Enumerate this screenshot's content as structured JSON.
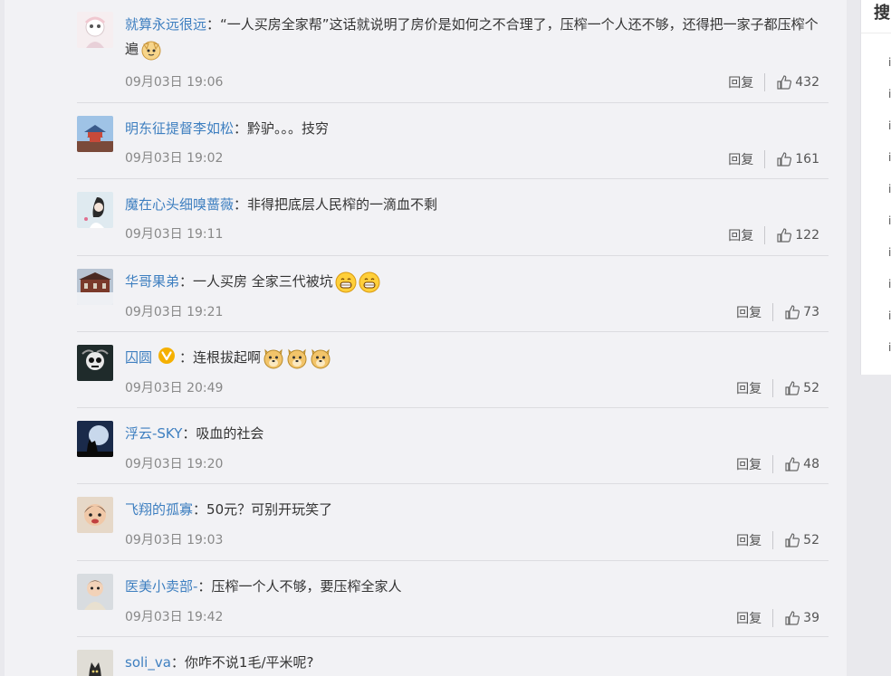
{
  "comments": [
    {
      "user": "就算永远很远",
      "sep": "：",
      "content": "“一人买房全家帮”这话就说明了房价是如何之不合理了，压榨一个人还不够，还得把一家子都压榨个遍",
      "time": "09月03日 19:06",
      "reply": "回复",
      "likes": "432"
    },
    {
      "user": "明东征提督李如松",
      "sep": "：",
      "content": "黔驴。。。技穷",
      "time": "09月03日 19:02",
      "reply": "回复",
      "likes": "161"
    },
    {
      "user": "魔在心头细嗅蔷薇",
      "sep": "：",
      "content": "非得把底层人民榨的一滴血不剩",
      "time": "09月03日 19:11",
      "reply": "回复",
      "likes": "122"
    },
    {
      "user": "华哥果弟",
      "sep": "：",
      "content": "一人买房 全家三代被坑",
      "time": "09月03日 19:21",
      "reply": "回复",
      "likes": "73"
    },
    {
      "user": "囚圆",
      "sep": "：",
      "content": "连根拔起啊",
      "time": "09月03日 20:49",
      "reply": "回复",
      "likes": "52"
    },
    {
      "user": "浮云-SKY",
      "sep": "：",
      "content": "吸血的社会",
      "time": "09月03日 19:20",
      "reply": "回复",
      "likes": "48"
    },
    {
      "user": "飞翔的孤寡",
      "sep": "：",
      "content": "50元？可别开玩笑了",
      "time": "09月03日 19:03",
      "reply": "回复",
      "likes": "52"
    },
    {
      "user": "医美小卖部-",
      "sep": "：",
      "content": "压榨一个人不够，要压榨全家人",
      "time": "09月03日 19:42",
      "reply": "回复",
      "likes": "39"
    },
    {
      "user": "soli_va",
      "sep": "：",
      "content": "你咋不说1毛/平米呢?"
    }
  ],
  "sidebar": {
    "title": "搜",
    "items": [
      "i",
      "i",
      "i",
      "i",
      "i",
      "i",
      "i",
      "i",
      "i",
      "i"
    ]
  },
  "colors": {
    "username": "#3e7fc0",
    "background": "#f2f2f5",
    "verified_badge": "#f5b000"
  },
  "icons": [
    "thumbs-up-icon",
    "verified-badge-icon",
    "cat-emoji-icon",
    "grin-emoji-icon",
    "doge-emoji-icon"
  ]
}
